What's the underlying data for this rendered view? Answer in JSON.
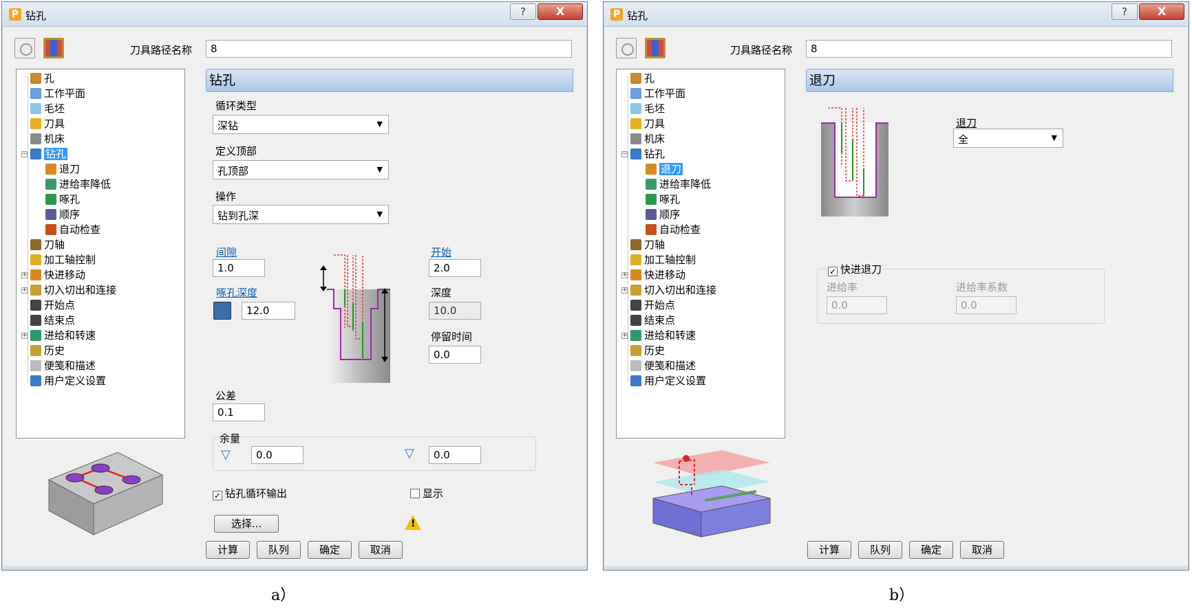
{
  "window_a": {
    "title": "钻孔",
    "help_glyph": "?",
    "close_glyph": "X",
    "toolpath_name_label": "刀具路径名称",
    "toolpath_name_value": "8",
    "tree": [
      {
        "label": "孔",
        "icon": "hole-icon"
      },
      {
        "label": "工作平面",
        "icon": "workplane-icon"
      },
      {
        "label": "毛坯",
        "icon": "block-icon"
      },
      {
        "label": "刀具",
        "icon": "tool-icon"
      },
      {
        "label": "机床",
        "icon": "machine-icon"
      },
      {
        "label": "钻孔",
        "icon": "drill-icon",
        "selected": true,
        "expandable": "−"
      },
      {
        "label": "退刀",
        "icon": "retract-icon"
      },
      {
        "label": "进给率降低",
        "icon": "feed-reduction-icon"
      },
      {
        "label": "啄孔",
        "icon": "peck-icon"
      },
      {
        "label": "顺序",
        "icon": "order-icon"
      },
      {
        "label": "自动检查",
        "icon": "auto-check-icon"
      },
      {
        "label": "刀轴",
        "icon": "tool-axis-icon"
      },
      {
        "label": "加工轴控制",
        "icon": "axis-control-icon"
      },
      {
        "label": "快进移动",
        "icon": "rapid-move-icon",
        "expandable": "+"
      },
      {
        "label": "切入切出和连接",
        "icon": "leads-links-icon",
        "expandable": "+"
      },
      {
        "label": "开始点",
        "icon": "start-point-icon"
      },
      {
        "label": "结束点",
        "icon": "end-point-icon"
      },
      {
        "label": "进给和转速",
        "icon": "feeds-speeds-icon",
        "expandable": "+"
      },
      {
        "label": "历史",
        "icon": "history-icon"
      },
      {
        "label": "便笺和描述",
        "icon": "notes-icon"
      },
      {
        "label": "用户定义设置",
        "icon": "user-settings-icon"
      }
    ],
    "section_title": "钻孔",
    "cycle_type_label": "循环类型",
    "cycle_type_value": "深钻",
    "define_top_label": "定义顶部",
    "define_top_value": "孔顶部",
    "operation_label": "操作",
    "operation_value": "钻到孔深",
    "clearance_label": "间隙",
    "clearance_value": "1.0",
    "peck_depth_label": "啄孔深度",
    "peck_depth_value": "12.0",
    "start_label": "开始",
    "start_value": "2.0",
    "depth_label": "深度",
    "depth_value": "10.0",
    "dwell_label": "停留时间",
    "dwell_value": "0.0",
    "tolerance_label": "公差",
    "tolerance_value": "0.1",
    "thickness_label": "余量",
    "thickness_radial_value": "0.0",
    "thickness_axial_value": "0.0",
    "output_cycle_label": "钻孔循环输出",
    "output_cycle_checked": true,
    "display_label": "显示",
    "display_checked": false,
    "select_button": "选择...",
    "warning_glyph": "!",
    "buttons": {
      "calculate": "计算",
      "queue": "队列",
      "ok": "确定",
      "cancel": "取消"
    }
  },
  "window_b": {
    "title": "钻孔",
    "help_glyph": "?",
    "close_glyph": "X",
    "toolpath_name_label": "刀具路径名称",
    "toolpath_name_value": "8",
    "tree": [
      {
        "label": "孔"
      },
      {
        "label": "工作平面"
      },
      {
        "label": "毛坯"
      },
      {
        "label": "刀具"
      },
      {
        "label": "机床"
      },
      {
        "label": "钻孔",
        "expandable": "−"
      },
      {
        "label": "退刀",
        "selected": true
      },
      {
        "label": "进给率降低"
      },
      {
        "label": "啄孔"
      },
      {
        "label": "顺序"
      },
      {
        "label": "自动检查"
      },
      {
        "label": "刀轴"
      },
      {
        "label": "加工轴控制"
      },
      {
        "label": "快进移动",
        "expandable": "+"
      },
      {
        "label": "切入切出和连接",
        "expandable": "+"
      },
      {
        "label": "开始点"
      },
      {
        "label": "结束点"
      },
      {
        "label": "进给和转速",
        "expandable": "+"
      },
      {
        "label": "历史"
      },
      {
        "label": "便笺和描述"
      },
      {
        "label": "用户定义设置"
      }
    ],
    "section_title": "退刀",
    "retract_label": "退刀",
    "retract_value": "全",
    "rapid_retract_label": "快进退刀",
    "rapid_retract_checked": true,
    "feed_rate_label": "进给率",
    "feed_rate_value": "0.0",
    "feed_factor_label": "进给率系数",
    "feed_factor_value": "0.0",
    "buttons": {
      "calculate": "计算",
      "queue": "队列",
      "ok": "确定",
      "cancel": "取消"
    }
  },
  "captions": {
    "a": "a）",
    "b": "b）"
  }
}
